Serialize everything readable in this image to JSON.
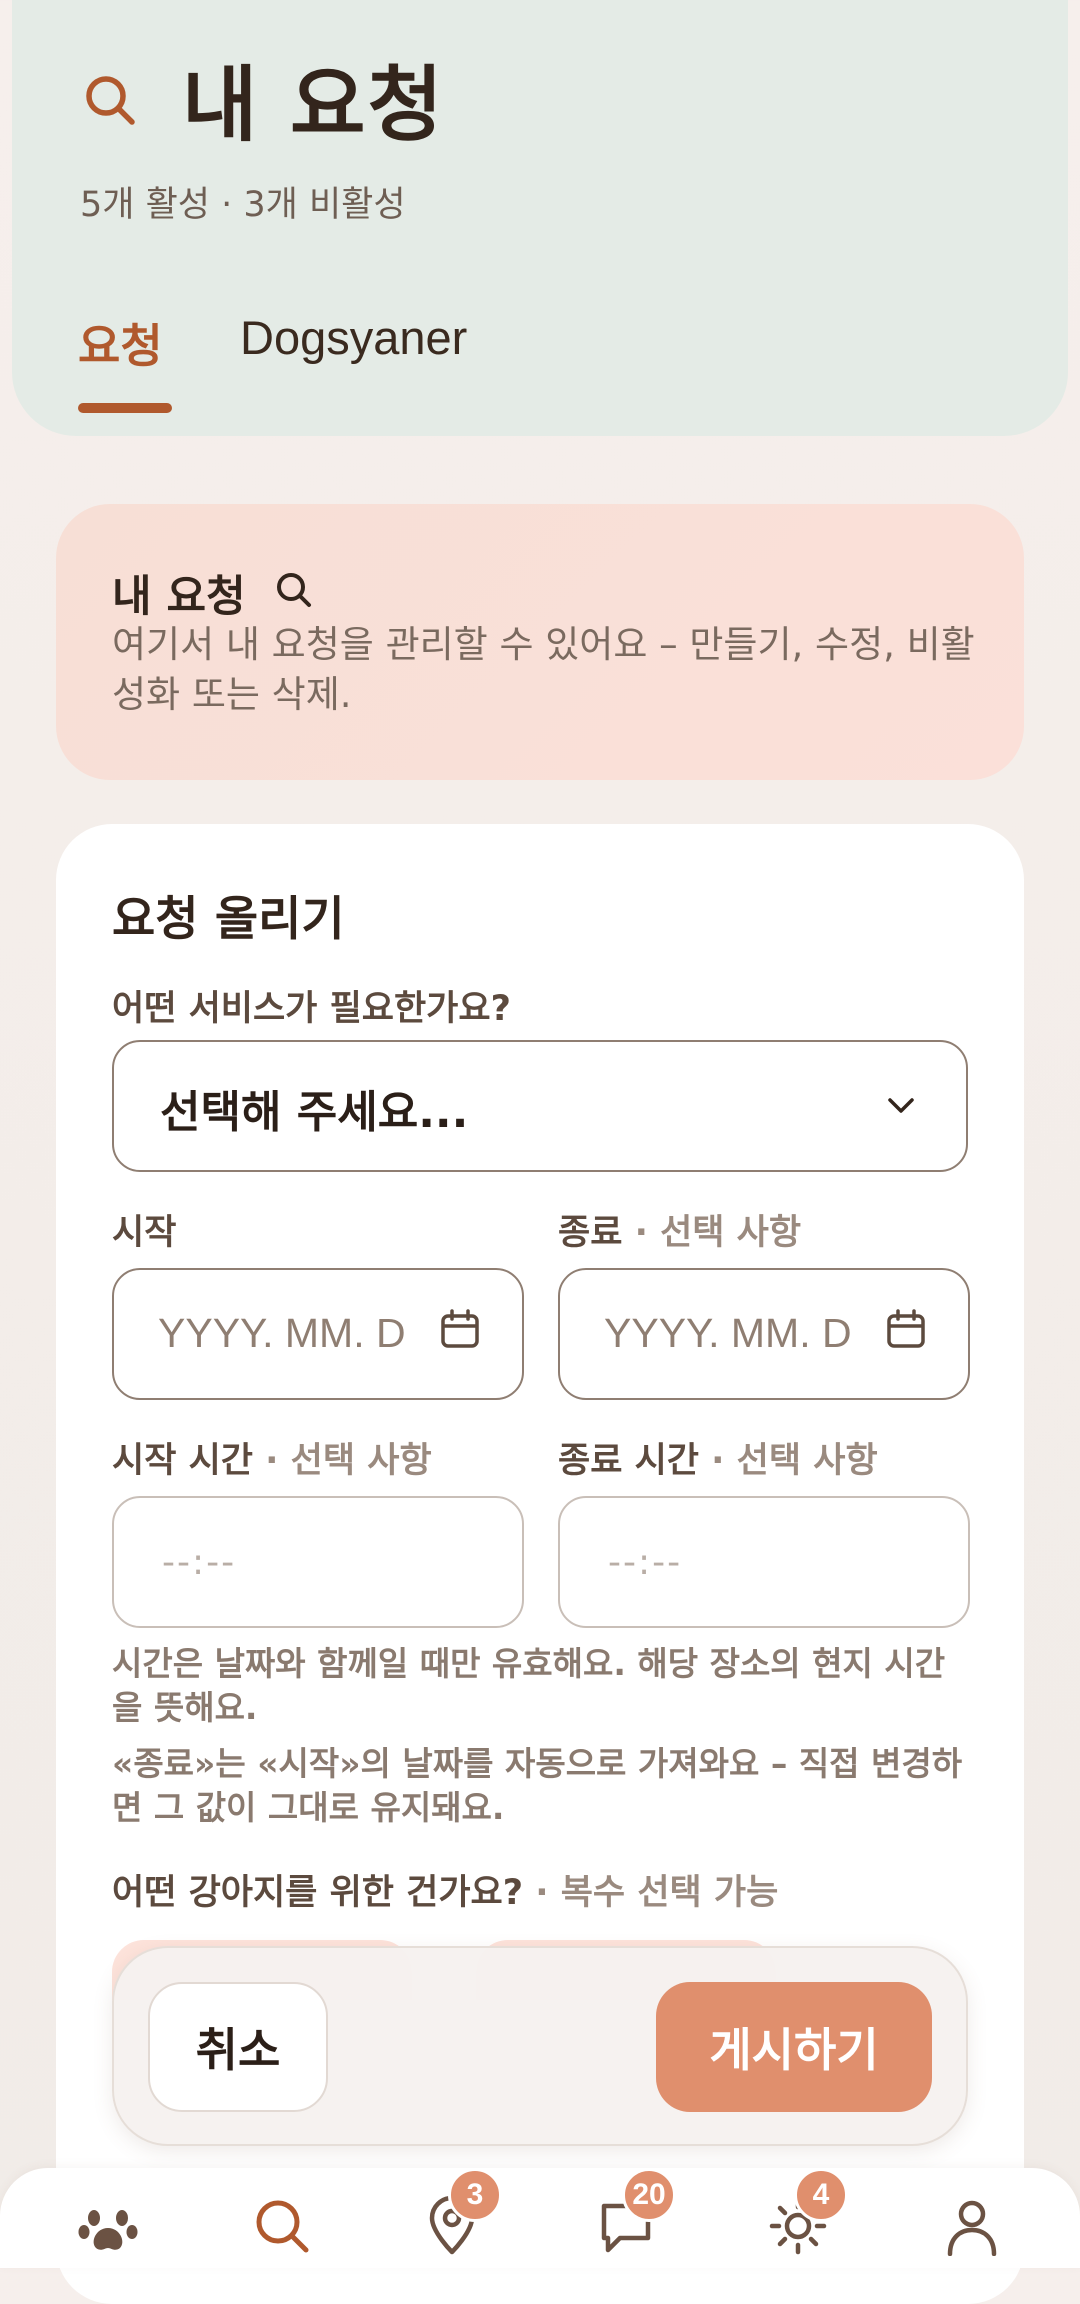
{
  "header": {
    "title": "내 요청",
    "subtitle": "5개 활성 · 3개 비활성",
    "tabs": [
      {
        "label": "요청",
        "active": true
      },
      {
        "label": "Dogsyaner",
        "active": false
      }
    ]
  },
  "intro": {
    "title": "내 요청",
    "text": "여기서 내 요청을 관리할 수 있어요 – 만들기, 수정, 비활성화 또는 삭제."
  },
  "form": {
    "title": "요청 올리기",
    "service_label": "어떤 서비스가 필요한가요?",
    "service_value": "선택해 주세요...",
    "start_label": "시작",
    "end_label": "종료",
    "optional_suffix": " · 선택 사항",
    "start_date_placeholder": "YYYY. MM. D",
    "end_date_placeholder": "YYYY. MM. D",
    "start_time_label": "시작 시간",
    "end_time_label": "종료 시간",
    "start_time_placeholder": "--:--",
    "end_time_placeholder": "--:--",
    "hint_time": "시간은 날짜와 함께일 때만 유효해요. 해당 장소의 현지 시간을 뜻해요.",
    "hint_end": "«종료»는 «시작»의 날짜를 자동으로 가져와요 – 직접 변경하면 그 값이 그대로 유지돼요.",
    "dogs_label": "어떤 강아지를 위한 건가요?",
    "dogs_suffix": " · 복수 선택 가능"
  },
  "actions": {
    "cancel": "취소",
    "post": "게시하기"
  },
  "nav": [
    {
      "icon": "paw-icon"
    },
    {
      "icon": "search-icon",
      "active": true
    },
    {
      "icon": "map-pin-icon",
      "badge": "3"
    },
    {
      "icon": "chat-icon",
      "badge": "20"
    },
    {
      "icon": "sun-icon",
      "badge": "4"
    },
    {
      "icon": "profile-icon"
    }
  ],
  "colors": {
    "accent": "#b0592d",
    "button": "#e08f6d",
    "header_bg": "#e4ebe6",
    "intro_bg": "#fbe0d9"
  }
}
